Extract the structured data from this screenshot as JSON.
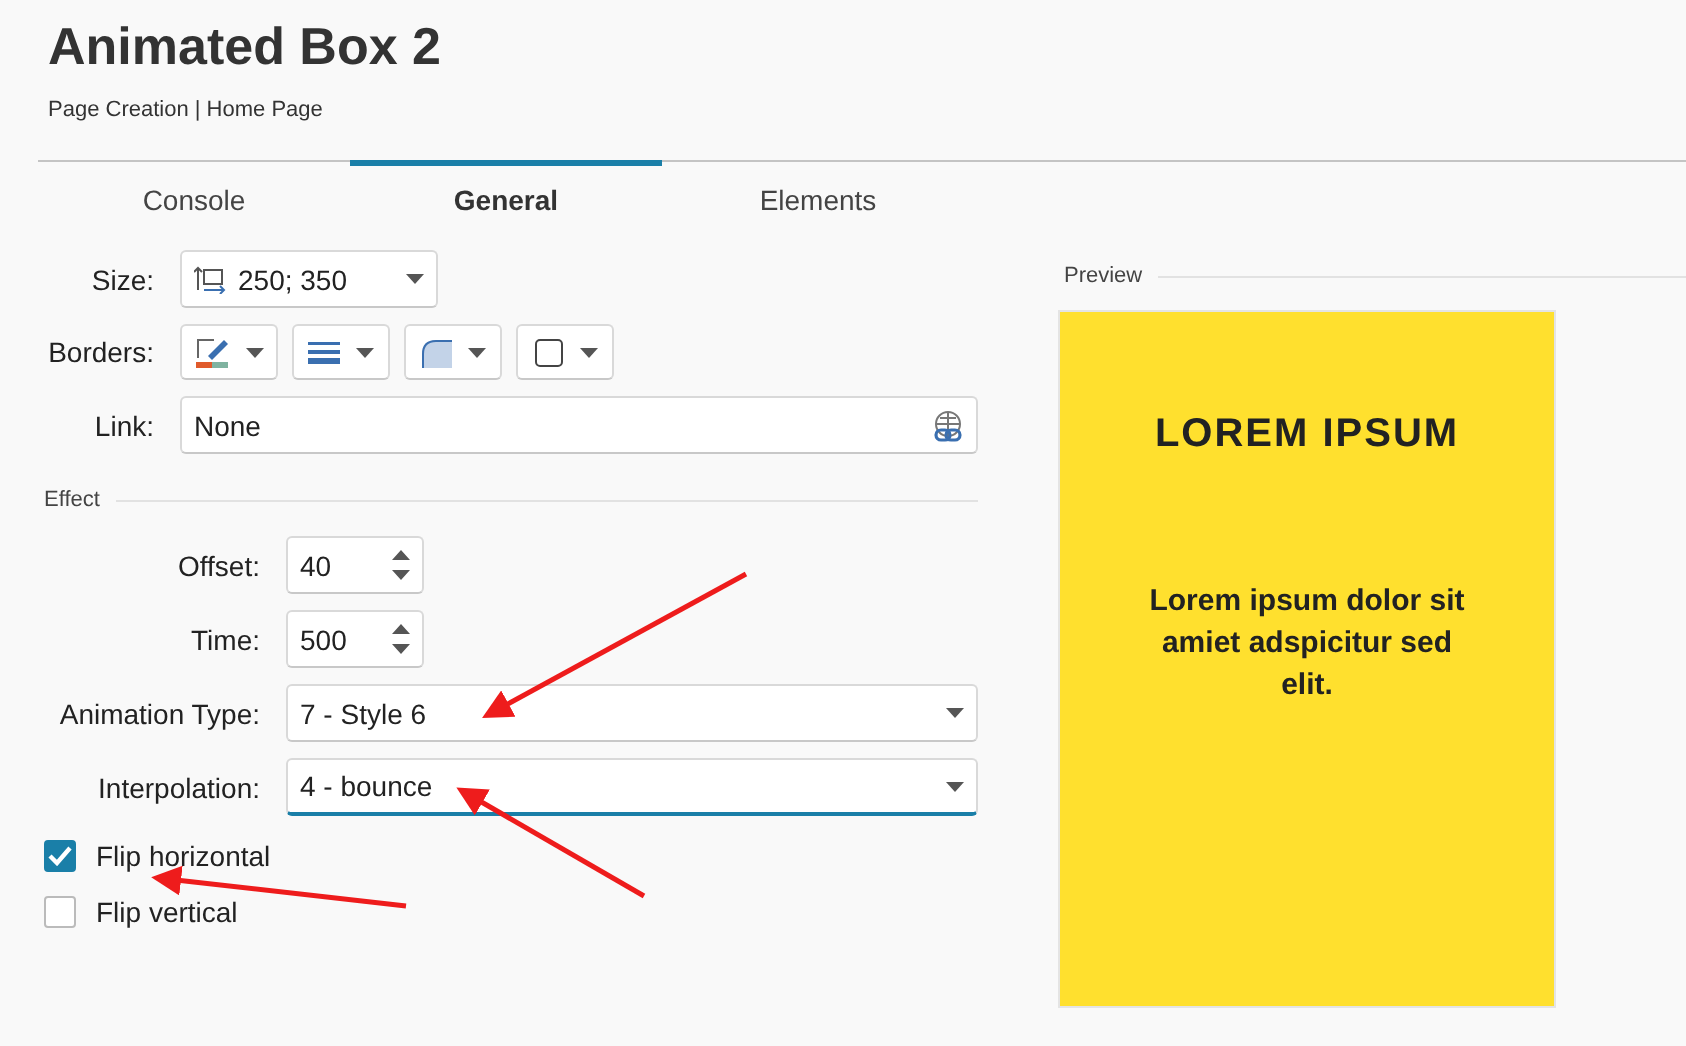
{
  "title": "Animated Box 2",
  "breadcrumb": "Page Creation | Home Page",
  "tabs": [
    {
      "label": "Console",
      "selected": false
    },
    {
      "label": "General",
      "selected": true
    },
    {
      "label": "Elements",
      "selected": false
    }
  ],
  "general": {
    "size": {
      "label": "Size:",
      "value": "250; 350"
    },
    "borders": {
      "label": "Borders:",
      "buttons": [
        {
          "kind": "color"
        },
        {
          "kind": "line"
        },
        {
          "kind": "corner"
        },
        {
          "kind": "shadow"
        }
      ]
    },
    "link": {
      "label": "Link:",
      "value": "None"
    }
  },
  "effect": {
    "title": "Effect",
    "fields": [
      {
        "kind": "spinner",
        "label": "Offset:",
        "value": "40",
        "focused": false
      },
      {
        "kind": "spinner",
        "label": "Time:",
        "value": "500",
        "focused": false
      },
      {
        "kind": "dropdown",
        "label": "Animation Type:",
        "value": "7 - Style 6",
        "focused": false
      },
      {
        "kind": "dropdown",
        "label": "Interpolation:",
        "value": "4 - bounce",
        "focused": true
      }
    ]
  },
  "checkboxes": [
    {
      "label": "Flip horizontal",
      "checked": true
    },
    {
      "label": "Flip vertical",
      "checked": false
    }
  ],
  "preview": {
    "title": "Preview",
    "heading": "LOREM IPSUM",
    "body": "Lorem ipsum dolor sit amiet adspicitur sed elit."
  }
}
